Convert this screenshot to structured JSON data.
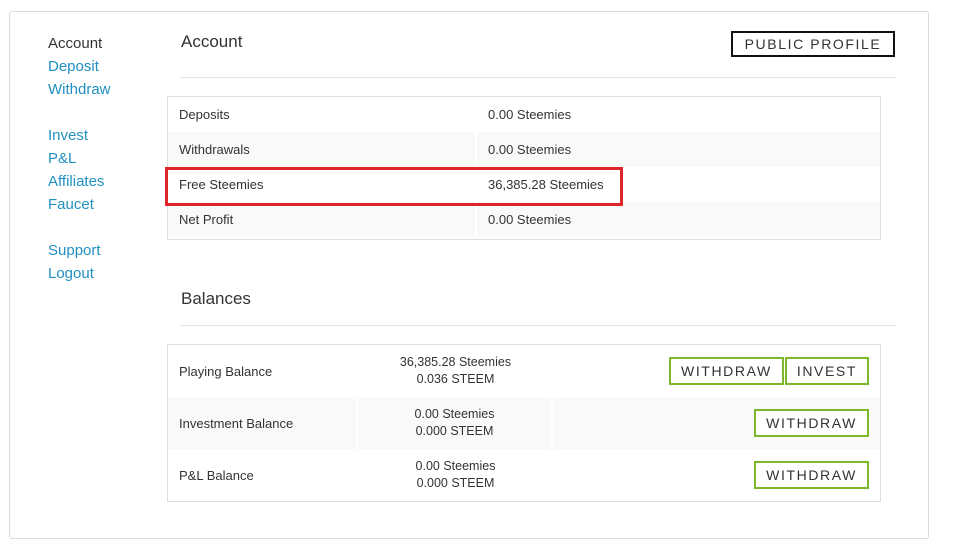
{
  "sidebar": {
    "group1": [
      "Account",
      "Deposit",
      "Withdraw"
    ],
    "group2": [
      "Invest",
      "P&L",
      "Affiliates",
      "Faucet"
    ],
    "group3": [
      "Support",
      "Logout"
    ],
    "active": "Account"
  },
  "account": {
    "title": "Account",
    "public_profile_label": "PUBLIC PROFILE",
    "rows": [
      {
        "label": "Deposits",
        "value": "0.00 Steemies"
      },
      {
        "label": "Withdrawals",
        "value": "0.00 Steemies"
      },
      {
        "label": "Free Steemies",
        "value": "36,385.28 Steemies"
      },
      {
        "label": "Net Profit",
        "value": "0.00 Steemies"
      }
    ]
  },
  "balances": {
    "title": "Balances",
    "rows": [
      {
        "label": "Playing Balance",
        "steemies": "36,385.28 Steemies",
        "steem": "0.036 STEEM",
        "withdraw_label": "WITHDRAW",
        "invest_label": "INVEST"
      },
      {
        "label": "Investment Balance",
        "steemies": "0.00 Steemies",
        "steem": "0.000 STEEM",
        "withdraw_label": "WITHDRAW"
      },
      {
        "label": "P&L Balance",
        "steemies": "0.00 Steemies",
        "steem": "0.000 STEEM",
        "withdraw_label": "WITHDRAW"
      }
    ]
  },
  "colors": {
    "link": "#2190c0",
    "highlight_border": "#e0242b",
    "action_border": "#7cb82a",
    "profile_border": "#111111"
  }
}
